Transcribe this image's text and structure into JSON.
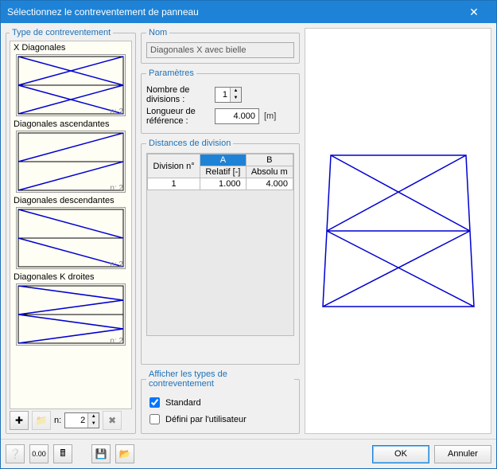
{
  "window": {
    "title": "Sélectionnez le contreventement de panneau"
  },
  "left": {
    "groupTitle": "Type de contreventement",
    "nCaption": "n: 2",
    "items": [
      {
        "label": "X Diagonales"
      },
      {
        "label": "Diagonales ascendantes"
      },
      {
        "label": "Diagonales descendantes"
      },
      {
        "label": "Diagonales K droites"
      }
    ],
    "toolbar": {
      "nLabel": "n:",
      "nValue": "2"
    }
  },
  "mid": {
    "nameGroup": "Nom",
    "nameValue": "Diagonales X avec bielle",
    "paramsGroup": "Paramètres",
    "divLabel": "Nombre de divisions :",
    "divValue": "1",
    "lenLabel": "Longueur de référence :",
    "lenValue": "4.000",
    "lenUnit": "[m]",
    "distGroup": "Distances de division",
    "table": {
      "h_div": "Division n°",
      "h_A": "A",
      "h_B": "B",
      "h_rel": "Relatif [-]",
      "h_abs": "Absolu m",
      "rows": [
        {
          "n": "1",
          "rel": "1.000",
          "abs": "4.000"
        }
      ]
    },
    "showGroup": "Afficher les types de contreventement",
    "chkStd": "Standard",
    "chkUser": "Défini par l'utilisateur"
  },
  "footer": {
    "ok": "OK",
    "cancel": "Annuler"
  }
}
